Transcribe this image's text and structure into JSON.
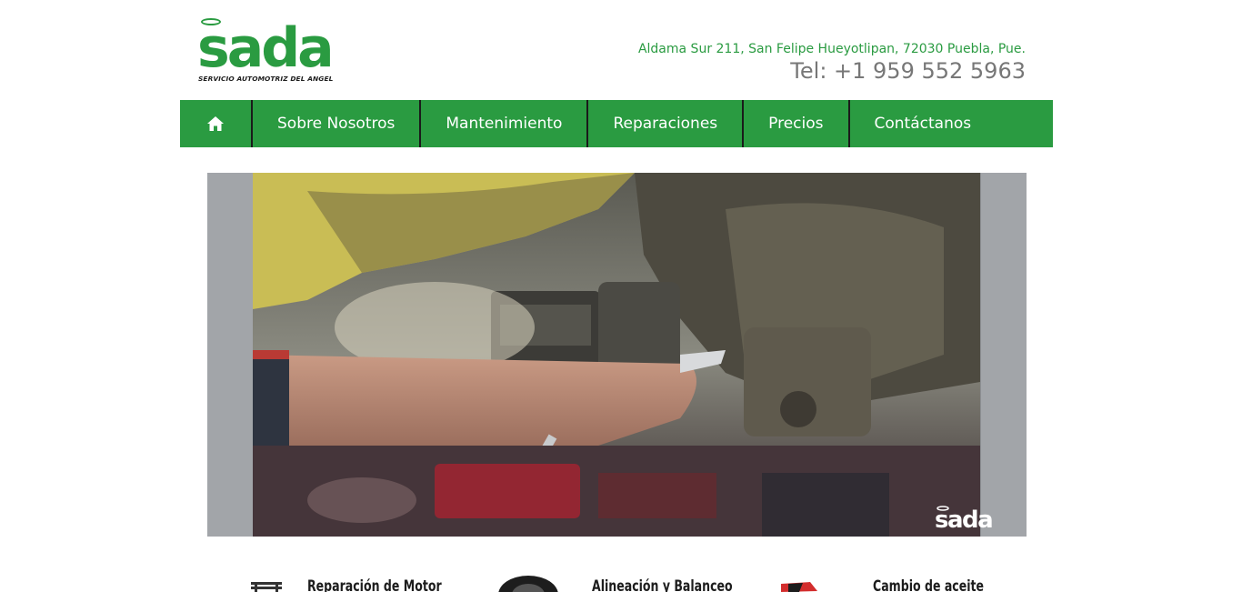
{
  "header": {
    "logo_text": "sada",
    "logo_tagline": "SERVICIO AUTOMOTRIZ DEL ANGEL",
    "address": "Aldama Sur 211, San Felipe Hueyotlipan, 72030 Puebla, Pue.",
    "phone": "Tel: +1 959 552 5963"
  },
  "nav": {
    "home_icon": "home-icon",
    "items": [
      {
        "label": "Sobre Nosotros"
      },
      {
        "label": "Mantenimiento"
      },
      {
        "label": "Reparaciones"
      },
      {
        "label": "Precios"
      },
      {
        "label": "Contáctanos"
      }
    ]
  },
  "hero": {
    "watermark_text": "sada"
  },
  "services": [
    {
      "title": "Reparación de Motor",
      "icon": "engine-icon"
    },
    {
      "title": "Alineación y Balanceo",
      "icon": "tire-icon"
    },
    {
      "title": "Cambio de aceite",
      "icon": "oil-can-icon"
    }
  ],
  "colors": {
    "brand_green": "#2a9b41",
    "phone_gray": "#777777",
    "nav_divider": "#1a1a1a"
  }
}
